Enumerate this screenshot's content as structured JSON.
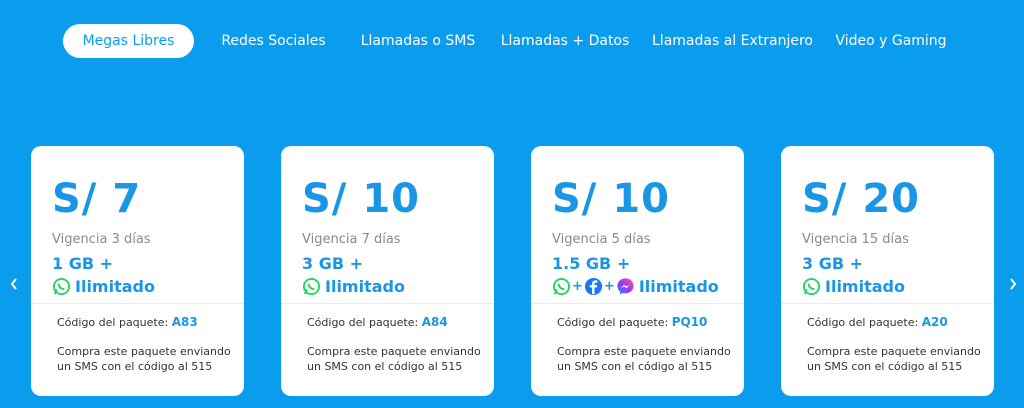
{
  "tabs": [
    {
      "label": "Megas Libres",
      "active": true
    },
    {
      "label": "Redes Sociales",
      "active": false
    },
    {
      "label": "Llamadas o SMS",
      "active": false
    },
    {
      "label": "Llamadas + Datos",
      "active": false
    },
    {
      "label": "Llamadas al Extranjero",
      "active": false
    },
    {
      "label": "Video y Gaming",
      "active": false
    }
  ],
  "nav": {
    "prev_icon": "chevron-left-icon",
    "next_icon": "chevron-right-icon"
  },
  "cards": [
    {
      "price": "S/ 7",
      "validity": "Vigencia 3 días",
      "data": "1 GB +",
      "apps": [
        "whatsapp-icon"
      ],
      "unlimited": "Ilimitado",
      "code_label": "Código del paquete:",
      "code": "A83",
      "instructions": "Compra este paquete enviando un SMS con el código al 515"
    },
    {
      "price": "S/ 10",
      "validity": "Vigencia 7 días",
      "data": "3 GB +",
      "apps": [
        "whatsapp-icon"
      ],
      "unlimited": "Ilimitado",
      "code_label": "Código del paquete:",
      "code": "A84",
      "instructions": "Compra este paquete enviando un SMS con el código al 515"
    },
    {
      "price": "S/ 10",
      "validity": "Vigencia 5 días",
      "data": "1.5 GB +",
      "apps": [
        "whatsapp-icon",
        "facebook-icon",
        "messenger-icon"
      ],
      "unlimited": "Ilimitado",
      "code_label": "Código del paquete:",
      "code": "PQ10",
      "instructions": "Compra este paquete enviando un SMS con el código al 515"
    },
    {
      "price": "S/ 20",
      "validity": "Vigencia 15 días",
      "data": "3 GB +",
      "apps": [
        "whatsapp-icon"
      ],
      "unlimited": "Ilimitado",
      "code_label": "Código del paquete:",
      "code": "A20",
      "instructions": "Compra este paquete enviando un SMS con el código al 515"
    }
  ],
  "colors": {
    "background": "#0a9dee",
    "accent": "#1a96e6",
    "whatsapp": "#25d366",
    "facebook": "#1877f2",
    "messenger": "#a033ff"
  }
}
